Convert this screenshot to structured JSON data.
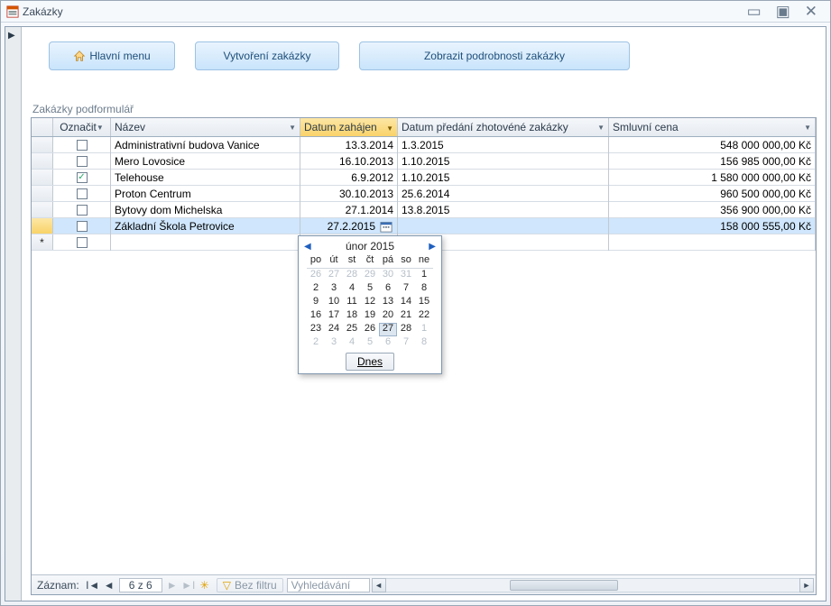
{
  "window": {
    "title": "Zakázky"
  },
  "buttons": {
    "home": "Hlavní menu",
    "create": "Vytvoření zakázky",
    "details": "Zobrazit podrobnosti zakázky"
  },
  "subform_label": "Zakázky podformulář",
  "columns": {
    "mark": "Označit",
    "name": "Název",
    "start": "Datum zahájen",
    "handover": "Datum předání zhotovéné zakázky",
    "price": "Smluvní cena"
  },
  "rows": [
    {
      "checked": false,
      "name": "Administrativní budova Vanice",
      "start": "13.3.2014",
      "handover": "1.3.2015",
      "price": "548 000 000,00 Kč"
    },
    {
      "checked": false,
      "name": "Mero Lovosice",
      "start": "16.10.2013",
      "handover": "1.10.2015",
      "price": "156 985 000,00 Kč"
    },
    {
      "checked": true,
      "name": "Telehouse",
      "start": "6.9.2012",
      "handover": "1.10.2015",
      "price": "1 580 000 000,00 Kč"
    },
    {
      "checked": false,
      "name": "Proton Centrum",
      "start": "30.10.2013",
      "handover": "25.6.2014",
      "price": "960 500 000,00 Kč"
    },
    {
      "checked": false,
      "name": "Bytovy dom Michelska",
      "start": "27.1.2014",
      "handover": "13.8.2015",
      "price": "356 900 000,00 Kč"
    },
    {
      "checked": false,
      "name": "Základní Škola Petrovice",
      "start": "27.2.2015",
      "handover": "",
      "price": "158 000 555,00 Kč"
    }
  ],
  "selected_row_index": 5,
  "datepicker": {
    "title": "únor 2015",
    "dow": [
      "po",
      "út",
      "st",
      "čt",
      "pá",
      "so",
      "ne"
    ],
    "weeks": [
      [
        {
          "d": "26",
          "o": true
        },
        {
          "d": "27",
          "o": true
        },
        {
          "d": "28",
          "o": true
        },
        {
          "d": "29",
          "o": true
        },
        {
          "d": "30",
          "o": true
        },
        {
          "d": "31",
          "o": true
        },
        {
          "d": "1"
        }
      ],
      [
        {
          "d": "2"
        },
        {
          "d": "3"
        },
        {
          "d": "4"
        },
        {
          "d": "5"
        },
        {
          "d": "6"
        },
        {
          "d": "7"
        },
        {
          "d": "8"
        }
      ],
      [
        {
          "d": "9"
        },
        {
          "d": "10"
        },
        {
          "d": "11"
        },
        {
          "d": "12"
        },
        {
          "d": "13"
        },
        {
          "d": "14"
        },
        {
          "d": "15"
        }
      ],
      [
        {
          "d": "16"
        },
        {
          "d": "17"
        },
        {
          "d": "18"
        },
        {
          "d": "19"
        },
        {
          "d": "20"
        },
        {
          "d": "21"
        },
        {
          "d": "22"
        }
      ],
      [
        {
          "d": "23"
        },
        {
          "d": "24"
        },
        {
          "d": "25"
        },
        {
          "d": "26"
        },
        {
          "d": "27",
          "sel": true
        },
        {
          "d": "28"
        },
        {
          "d": "1",
          "o": true
        }
      ],
      [
        {
          "d": "2",
          "o": true
        },
        {
          "d": "3",
          "o": true
        },
        {
          "d": "4",
          "o": true
        },
        {
          "d": "5",
          "o": true
        },
        {
          "d": "6",
          "o": true
        },
        {
          "d": "7",
          "o": true
        },
        {
          "d": "8",
          "o": true
        }
      ]
    ],
    "today_label": "Dnes"
  },
  "recordnav": {
    "label": "Záznam:",
    "position": "6 z 6",
    "filter": "Bez filtru",
    "search_placeholder": "Vyhledávání"
  }
}
